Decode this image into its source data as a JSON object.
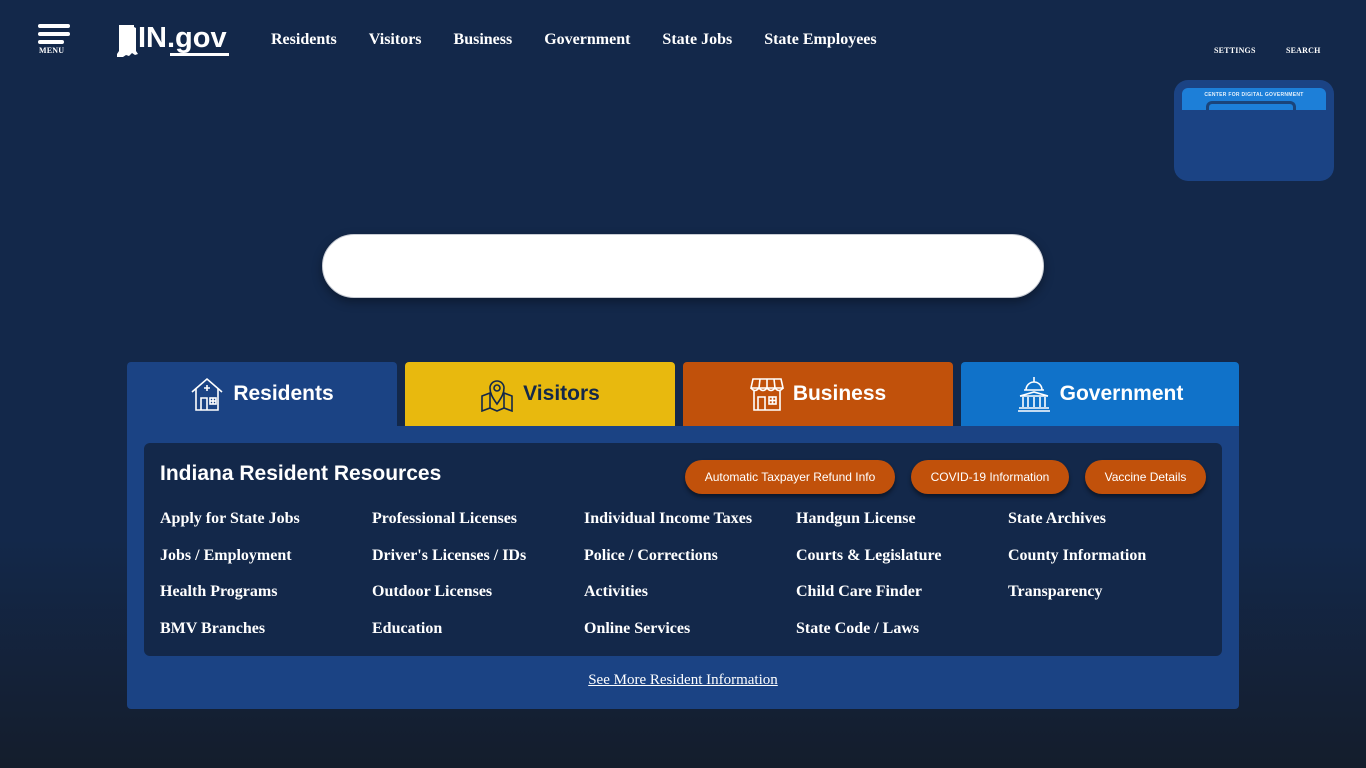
{
  "header": {
    "menu_label": "MENU",
    "logo_text": "IN.gov",
    "nav": [
      "Residents",
      "Visitors",
      "Business",
      "Government",
      "State Jobs",
      "State Employees"
    ],
    "settings_label": "SETTINGS",
    "search_label": "SEARCH"
  },
  "award": {
    "caption": "CENTER FOR DIGITAL GOVERNMENT"
  },
  "search": {
    "placeholder": ""
  },
  "tabs": [
    {
      "label": "Residents",
      "icon": "house-icon",
      "color": "#1b4384"
    },
    {
      "label": "Visitors",
      "icon": "map-pin-icon",
      "color": "#e8b90e"
    },
    {
      "label": "Business",
      "icon": "storefront-icon",
      "color": "#c1510b"
    },
    {
      "label": "Government",
      "icon": "capitol-icon",
      "color": "#1072c9"
    }
  ],
  "panel": {
    "title": "Indiana Resident Resources",
    "pills": [
      "Automatic Taxpayer Refund Info",
      "COVID-19 Information",
      "Vaccine Details"
    ],
    "links": [
      "Apply for State Jobs",
      "Professional Licenses",
      "Individual Income Taxes",
      "Handgun License",
      "State Archives",
      "Jobs / Employment",
      "Driver's Licenses / IDs",
      "Police / Corrections",
      "Courts & Legislature",
      "County Information",
      "Health Programs",
      "Outdoor Licenses",
      "Activities",
      "Child Care Finder",
      "Transparency",
      "BMV Branches",
      "Education",
      "Online Services",
      "State Code / Laws"
    ],
    "see_more": "See More Resident Information"
  },
  "colors": {
    "background": "#13284a",
    "panel": "#1b4384",
    "accent_orange": "#c1510b",
    "accent_yellow": "#e8b90e",
    "accent_blue": "#1072c9"
  }
}
